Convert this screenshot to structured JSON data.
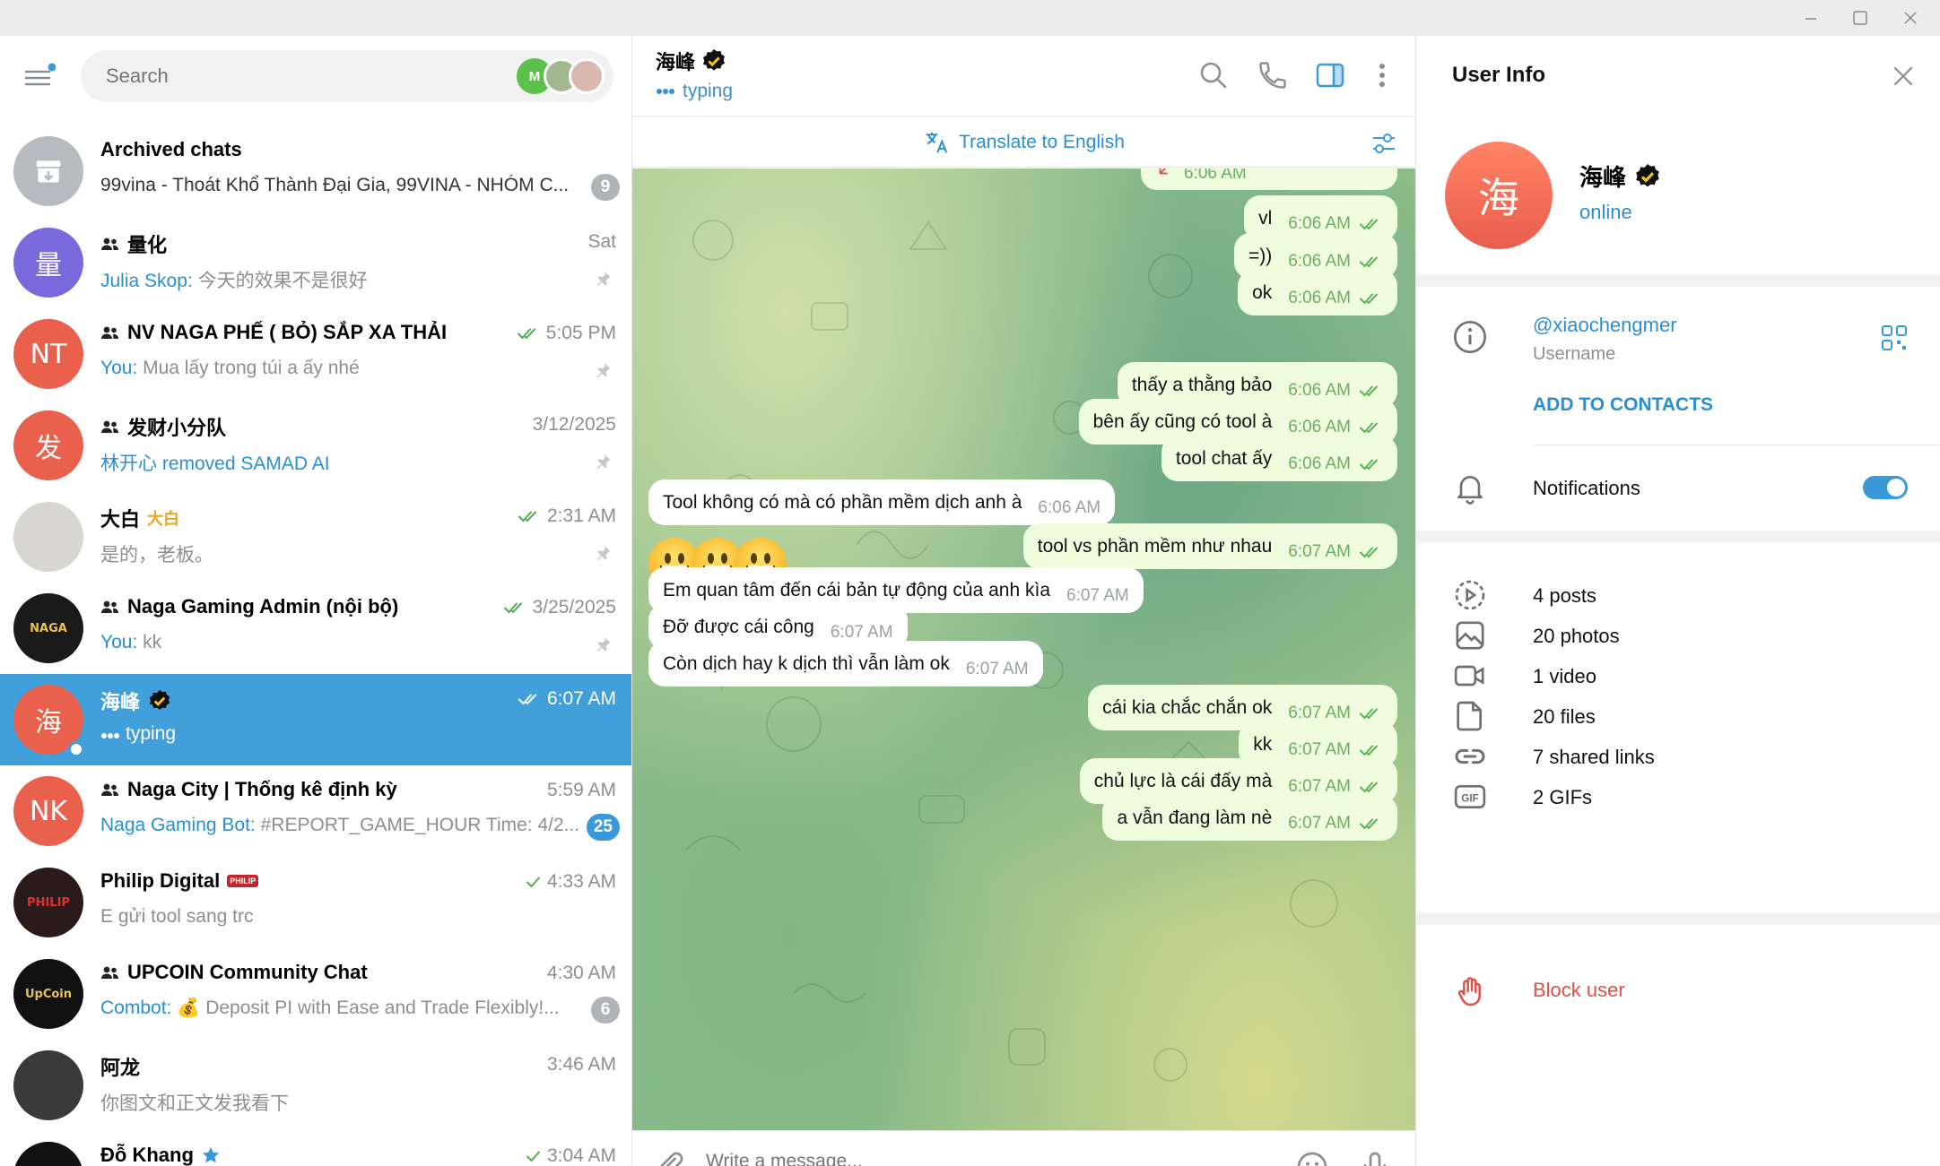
{
  "window": {
    "min": "minimize",
    "max": "maximize",
    "close": "close"
  },
  "left": {
    "search_placeholder": "Search",
    "stories": [
      {
        "initial": "M",
        "color": "#5cc14a"
      },
      {
        "initial": "",
        "color": "#a3b88e"
      },
      {
        "initial": "",
        "color": "#d8b8b0"
      }
    ],
    "chats": [
      {
        "name": "Archived chats",
        "time": "",
        "sender": "",
        "preview": "99vina - Thoát Khổ Thành Đại Gia, 99VINA - NHÓM C...",
        "badge": "9",
        "avatar": {
          "text": "",
          "color": "#b6bbc0",
          "icon": "archive-icon"
        },
        "group": false,
        "pinned": false,
        "checks": false
      },
      {
        "name": "量化",
        "time": "Sat",
        "sender": "Julia Skop:",
        "preview": " 今天的效果不是很好",
        "badge": "",
        "avatar": {
          "text": "量",
          "color": "#7a69dc"
        },
        "group": true,
        "pinned": true,
        "checks": false
      },
      {
        "name": "NV NAGA PHẾ ( BỎ) SẮP XA THẢI",
        "time": "5:05 PM",
        "sender": "You:",
        "preview": " Mua lấy trong túi a ấy nhé",
        "badge": "",
        "avatar": {
          "text": "NT",
          "color": "#e9604c"
        },
        "group": true,
        "pinned": true,
        "checks": true
      },
      {
        "name": "发财小分队",
        "time": "3/12/2025",
        "sender": "林开心 removed SAMAD AI",
        "preview": "",
        "badge": "",
        "avatar": {
          "text": "发",
          "color": "#e9604c"
        },
        "group": true,
        "pinned": true,
        "checks": false
      },
      {
        "name": "大白",
        "time": "2:31 AM",
        "sender": "",
        "preview": "是的，老板。",
        "badge": "",
        "avatar": {
          "text": "",
          "color": "#d8d6d2"
        },
        "group": false,
        "pinned": true,
        "checks": true,
        "tag": "大白"
      },
      {
        "name": "Naga Gaming Admin (nội bộ)",
        "time": "3/25/2025",
        "sender": "You:",
        "preview": " kk",
        "badge": "",
        "avatar": {
          "text": "NAGA",
          "color": "#1a1a1a"
        },
        "group": true,
        "pinned": true,
        "checks": true
      },
      {
        "name": "海峰",
        "time": "6:07 AM",
        "sender": "",
        "preview": "typing",
        "badge": "",
        "avatar": {
          "text": "海",
          "color": "#e9604c"
        },
        "group": false,
        "pinned": false,
        "checks": true,
        "active": true,
        "verified": true
      },
      {
        "name": "Naga City | Thống kê định kỳ",
        "time": "5:59 AM",
        "sender": "Naga Gaming Bot:",
        "preview": " #REPORT_GAME_HOUR Time: 4/2...",
        "badge": "25",
        "avatar": {
          "text": "NK",
          "color": "#e9604c"
        },
        "group": true,
        "pinned": false,
        "checks": false,
        "badge_blue": true
      },
      {
        "name": "Philip Digital",
        "time": "4:33 AM",
        "sender": "",
        "preview": "E gửi tool sang trc",
        "badge": "",
        "avatar": {
          "text": "PHILIP",
          "color": "#2b1a1a"
        },
        "group": false,
        "pinned": false,
        "checks": true,
        "single": true,
        "tag": "PHILIP"
      },
      {
        "name": "UPCOIN Community Chat",
        "time": "4:30 AM",
        "sender": "Combot:",
        "preview": " 💰 Deposit PI with Ease and Trade Flexibly!...",
        "badge": "6",
        "avatar": {
          "text": "UpCoin",
          "color": "#111111"
        },
        "group": true,
        "pinned": false,
        "checks": false
      },
      {
        "name": "阿龙",
        "time": "3:46 AM",
        "sender": "",
        "preview": "你图文和正文发我看下",
        "badge": "",
        "avatar": {
          "text": "",
          "color": "#3a3a3a"
        },
        "group": false,
        "pinned": false,
        "checks": false
      },
      {
        "name": "Đỗ Khang",
        "time": "3:04 AM",
        "sender": "",
        "preview": "",
        "badge": "",
        "avatar": {
          "text": "",
          "color": "#111111"
        },
        "group": false,
        "pinned": false,
        "checks": true,
        "single": true,
        "star": true
      }
    ]
  },
  "chat": {
    "peer_name": "海峰",
    "status": "typing",
    "translate": "Translate to English",
    "composer_placeholder": "Write a message...",
    "messages": [
      {
        "dir": "out",
        "text": "",
        "time": "6:06 AM",
        "partial": true
      },
      {
        "dir": "out",
        "text": "vl",
        "time": "6:06 AM"
      },
      {
        "dir": "out",
        "text": "=))",
        "time": "6:06 AM"
      },
      {
        "dir": "out",
        "text": "ok",
        "time": "6:06 AM"
      },
      {
        "dir": "out",
        "text": "thấy a thằng bảo",
        "time": "6:06 AM"
      },
      {
        "dir": "out",
        "text": "bên ấy cũng có tool à",
        "time": "6:06 AM"
      },
      {
        "dir": "out",
        "text": "tool chat ấy",
        "time": "6:06 AM"
      },
      {
        "dir": "in",
        "text": "Tool không có mà có phần mềm dịch anh à",
        "time": "6:06 AM"
      },
      {
        "dir": "out",
        "text": "tool vs phần mềm như nhau",
        "time": "6:07 AM"
      },
      {
        "dir": "in",
        "text": "Em quan tâm đến cái bản tự động của anh kìa",
        "time": "6:07 AM"
      },
      {
        "dir": "in",
        "text": "Đỡ được cái công",
        "time": "6:07 AM"
      },
      {
        "dir": "in",
        "text": "Còn dịch hay k dịch thì vẫn làm ok",
        "time": "6:07 AM"
      },
      {
        "dir": "out",
        "text": "cái kia chắc chắn ok",
        "time": "6:07 AM"
      },
      {
        "dir": "out",
        "text": "kk",
        "time": "6:07 AM"
      },
      {
        "dir": "out",
        "text": "chủ lực là cái đấy mà",
        "time": "6:07 AM"
      },
      {
        "dir": "out",
        "text": "a vẫn đang làm nè",
        "time": "6:07 AM"
      }
    ]
  },
  "info": {
    "title": "User Info",
    "name": "海峰",
    "avatar_text": "海",
    "status": "online",
    "username": "@xiaochengmer",
    "username_label": "Username",
    "add_contact": "ADD TO CONTACTS",
    "notifications": "Notifications",
    "media": [
      {
        "icon": "stories-icon",
        "label": "4 posts"
      },
      {
        "icon": "photo-icon",
        "label": "20 photos"
      },
      {
        "icon": "video-icon",
        "label": "1 video"
      },
      {
        "icon": "file-icon",
        "label": "20 files"
      },
      {
        "icon": "link-icon",
        "label": "7 shared links"
      },
      {
        "icon": "gif-icon",
        "label": "2 GIFs"
      }
    ],
    "block": "Block user"
  }
}
